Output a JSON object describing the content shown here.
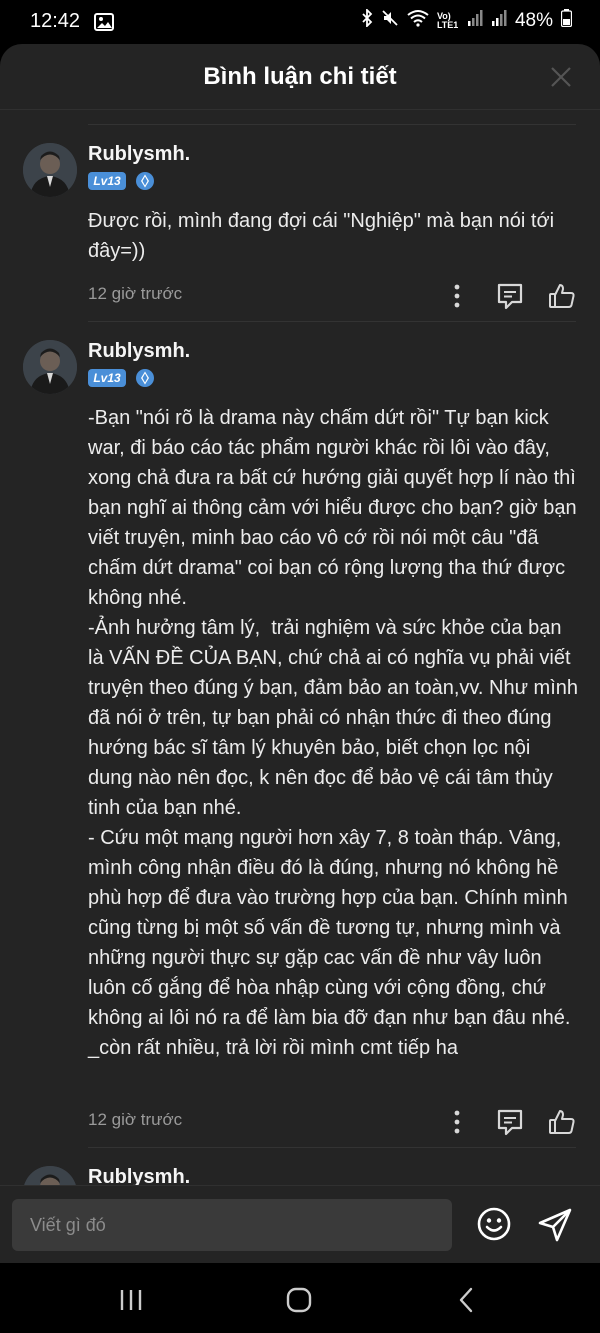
{
  "status_bar": {
    "time": "12:42",
    "battery": "48%",
    "network": "Vo) LTE1"
  },
  "header": {
    "title": "Bình luận chi tiết"
  },
  "comments": [
    {
      "username": "Rublysmh.",
      "level": "Lv13",
      "text": "Được rồi, mình đang đợi cái \"Nghiệp\" mà bạn nói tới đây=))",
      "time": "12 giờ trước"
    },
    {
      "username": "Rublysmh.",
      "level": "Lv13",
      "text": "-Bạn \"nói rõ là drama này chấm dứt rồi\" Tự bạn kick war, đi báo cáo tác phẩm người khác rồi lôi vào đây, xong chả đưa ra bất cứ hướng giải quyết hợp lí nào thì bạn nghĩ ai thông cảm với hiểu được cho bạn? giờ bạn viết truyện, minh bao cáo vô cớ rồi nói một câu \"đã chấm dứt drama\" coi bạn có rộng lượng tha thứ được không nhé.\n-Ảnh hưởng tâm lý,  trải nghiệm và sức khỏe của bạn là VẤN ĐỀ CỦA BẠN, chứ chả ai có nghĩa vụ phải viết truyện theo đúng ý bạn, đảm bảo an toàn,vv. Như mình đã nói ở trên, tự bạn phải có nhận thức đi theo đúng hướng bác sĩ tâm lý khuyên bảo, biết chọn lọc nội dung nào nên đọc, k nên đọc để bảo vệ cái tâm thủy tinh của bạn nhé.\n- Cứu một mạng người hơn xây 7, 8 toàn tháp. Vâng, mình công nhận điều đó là đúng, nhưng nó không hề phù hợp để đưa vào trường hợp của bạn. Chính mình cũng từng bị một số vấn đề tương tự, nhưng mình và những người thực sự gặp cac vấn đề như vây luôn luôn cố gắng để hòa nhập cùng với cộng đồng, chứ không ai lôi nó ra để làm bia đỡ đạn như bạn đâu nhé.\n_còn rất nhiều, trả lời rồi mình cmt tiếp ha",
      "time": "12 giờ trước"
    },
    {
      "username": "Rublysmh."
    }
  ],
  "input": {
    "placeholder": "Viết gì đó"
  },
  "icons": {
    "close": "close-icon",
    "more": "more-vertical-icon",
    "reply": "reply-comment-icon",
    "like": "thumbs-up-icon",
    "emoji": "emoji-icon",
    "send": "send-icon",
    "rank": "diamond-rank-icon"
  },
  "colors": {
    "sheet_bg": "#242424",
    "level_badge": "#4a8fd8",
    "muted_text": "#9a9a9a"
  }
}
